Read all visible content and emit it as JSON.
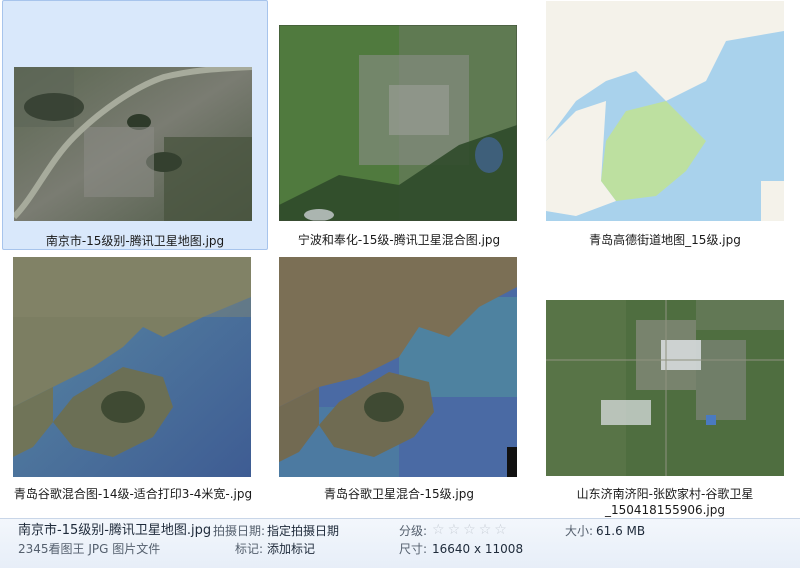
{
  "files": [
    {
      "name": "南京市-15级别-腾讯卫星地图.jpg",
      "selected": true
    },
    {
      "name": "宁波和奉化-15级-腾讯卫星混合图.jpg"
    },
    {
      "name": "青岛高德街道地图_15级.jpg"
    },
    {
      "name": "青岛谷歌混合图-14级-适合打印3-4米宽-.jpg"
    },
    {
      "name": "青岛谷歌卫星混合-15级.jpg"
    },
    {
      "name_line1": "山东济南济阳-张欧家村-谷歌卫星",
      "name_line2": "_150418155906.jpg"
    }
  ],
  "status": {
    "filename": "南京市-15级别-腾讯卫星地图.jpg",
    "filetype": "2345看图王 JPG 图片文件",
    "date_label": "拍摄日期:",
    "date_value": "指定拍摄日期",
    "tag_label": "标记:",
    "tag_value": "添加标记",
    "rating_label": "分级:",
    "rating_value": 0,
    "rating_max": 5,
    "size_label": "大小:",
    "size_value": "61.6 MB",
    "dims_label": "尺寸:",
    "dims_value": "16640 x 11008"
  },
  "colors": {
    "selection_bg": "#d9e8fb",
    "selection_border": "#a7c4ec",
    "statusbar_bg": "#eaf0f8",
    "star_empty": "#c8ced6"
  }
}
